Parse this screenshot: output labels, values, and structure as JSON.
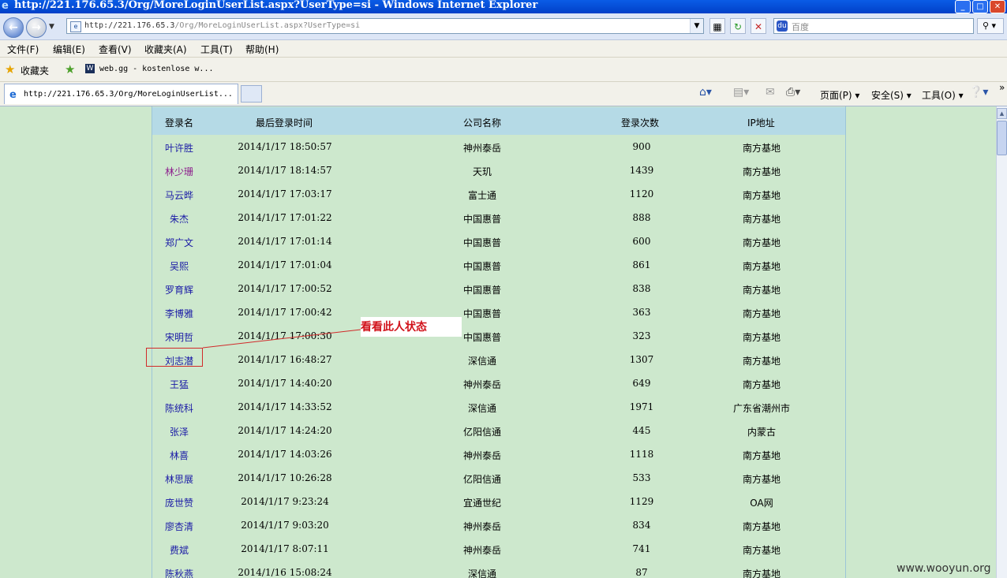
{
  "window": {
    "title": "http://221.176.65.3/Org/MoreLoginUserList.aspx?UserType=si - Windows Internet Explorer",
    "min": "_",
    "max": "□",
    "close": "✕"
  },
  "address": {
    "url_host": "http://221.176.65.3",
    "url_path": "/Org/MoreLoginUserList.aspx?UserType=si",
    "search_placeholder": "百度"
  },
  "menu": [
    "文件(F)",
    "编辑(E)",
    "查看(V)",
    "收藏夹(A)",
    "工具(T)",
    "帮助(H)"
  ],
  "favorites": {
    "label": "收藏夹",
    "link": "web.gg - kostenlose w..."
  },
  "tab": {
    "title": "http://221.176.65.3/Org/MoreLoginUserList..."
  },
  "commands": {
    "page": "页面(P)",
    "safety": "安全(S)",
    "tools": "工具(O)"
  },
  "table": {
    "headers": [
      "登录名",
      "最后登录时间",
      "公司名称",
      "登录次数",
      "IP地址"
    ],
    "rows": [
      [
        "叶许胜",
        "2014/1/17 18:50:57",
        "神州泰岳",
        "900",
        "南方基地"
      ],
      [
        "林少珊",
        "2014/1/17 18:14:57",
        "天玑",
        "1439",
        "南方基地"
      ],
      [
        "马云晔",
        "2014/1/17 17:03:17",
        "富士通",
        "1120",
        "南方基地"
      ],
      [
        "朱杰",
        "2014/1/17 17:01:22",
        "中国惠普",
        "888",
        "南方基地"
      ],
      [
        "郑广文",
        "2014/1/17 17:01:14",
        "中国惠普",
        "600",
        "南方基地"
      ],
      [
        "吴熙",
        "2014/1/17 17:01:04",
        "中国惠普",
        "861",
        "南方基地"
      ],
      [
        "罗育辉",
        "2014/1/17 17:00:52",
        "中国惠普",
        "838",
        "南方基地"
      ],
      [
        "李博雅",
        "2014/1/17 17:00:42",
        "中国惠普",
        "363",
        "南方基地"
      ],
      [
        "宋明哲",
        "2014/1/17 17:00:30",
        "中国惠普",
        "323",
        "南方基地"
      ],
      [
        "刘志潜",
        "2014/1/17 16:48:27",
        "深信通",
        "1307",
        "南方基地"
      ],
      [
        "王猛",
        "2014/1/17 14:40:20",
        "神州泰岳",
        "649",
        "南方基地"
      ],
      [
        "陈统科",
        "2014/1/17 14:33:52",
        "深信通",
        "1971",
        "广东省潮州市"
      ],
      [
        "张泽",
        "2014/1/17 14:24:20",
        "亿阳信通",
        "445",
        "内蒙古"
      ],
      [
        "林喜",
        "2014/1/17 14:03:26",
        "神州泰岳",
        "1118",
        "南方基地"
      ],
      [
        "林思展",
        "2014/1/17 10:26:28",
        "亿阳信通",
        "533",
        "南方基地"
      ],
      [
        "庞世赞",
        "2014/1/17 9:23:24",
        "宜通世纪",
        "1129",
        "OA网"
      ],
      [
        "廖杏清",
        "2014/1/17 9:03:20",
        "神州泰岳",
        "834",
        "南方基地"
      ],
      [
        "费斌",
        "2014/1/17 8:07:11",
        "神州泰岳",
        "741",
        "南方基地"
      ],
      [
        "陈秋燕",
        "2014/1/16 15:08:24",
        "深信通",
        "87",
        "南方基地"
      ]
    ]
  },
  "annotation": "看看此人状态",
  "watermark": "www.wooyun.org"
}
